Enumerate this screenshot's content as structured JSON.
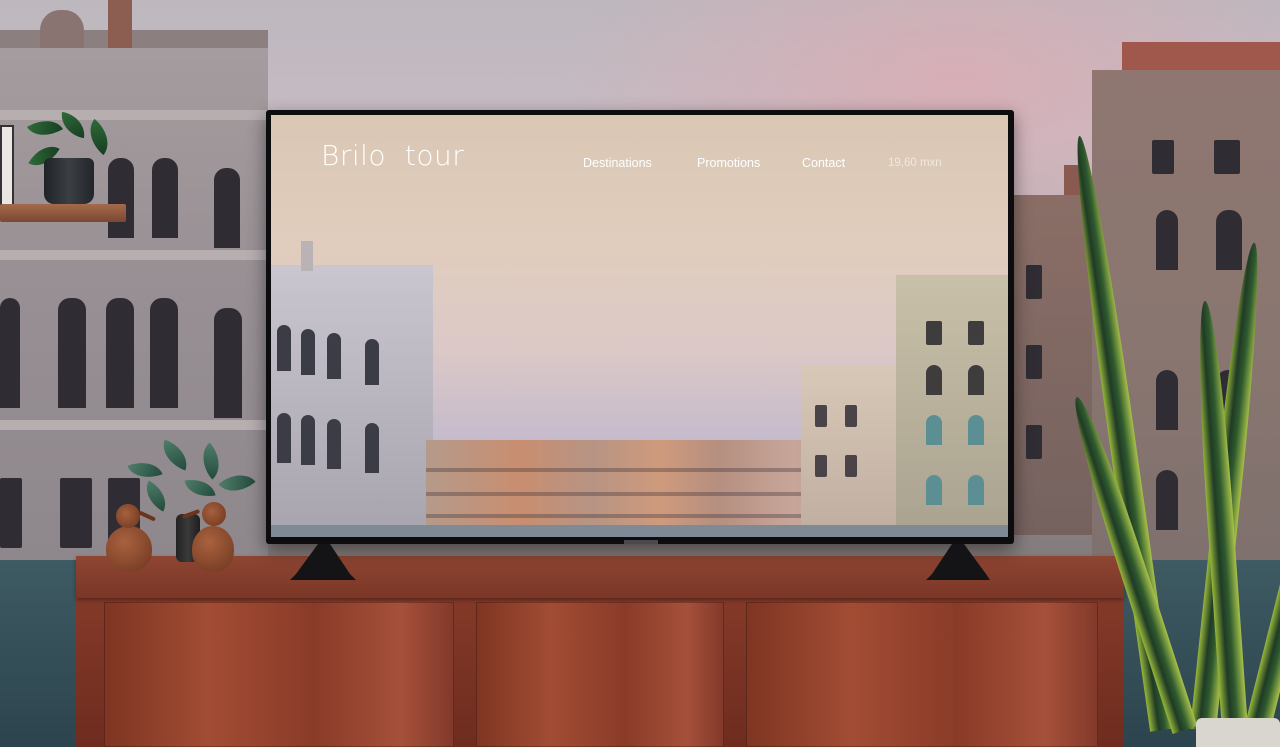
{
  "site": {
    "logo": "Brilo  tour",
    "nav": [
      "Destinations",
      "Promotions",
      "Contact"
    ],
    "price": "19,60 mxn"
  },
  "colors": {
    "cabinet_wood": "#8a3d2a",
    "tv_bezel": "#0d0d0f",
    "screen_sky_top": "#d9c7b4",
    "screen_sky_bottom": "#aeaec3",
    "nav_text": "#ffffff"
  },
  "icons": [
    "potted-plant-icon",
    "wooden-bird-figurine-icon",
    "snake-plant-icon"
  ]
}
